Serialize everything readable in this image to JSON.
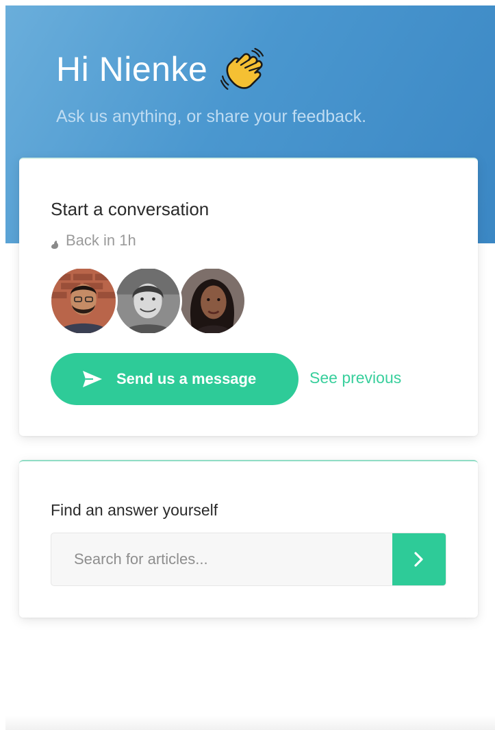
{
  "header": {
    "greeting": "Hi Nienke",
    "greeting_icon": "waving-hand-icon",
    "subtitle": "Ask us anything, or share your feedback.",
    "gradient_start": "#6aaedb",
    "gradient_end": "#3b87c4"
  },
  "conversation": {
    "title": "Start a conversation",
    "status": "Back in 1h",
    "status_icon": "clock-icon",
    "avatars": [
      "team-member-1",
      "team-member-2",
      "team-member-3"
    ],
    "send_button": "Send us a message",
    "send_icon": "send-arrow-icon",
    "see_previous": "See previous",
    "accent": "#2ecb98"
  },
  "search": {
    "title": "Find an answer yourself",
    "placeholder": "Search for articles...",
    "value": "",
    "submit_icon": "chevron-right-icon"
  }
}
